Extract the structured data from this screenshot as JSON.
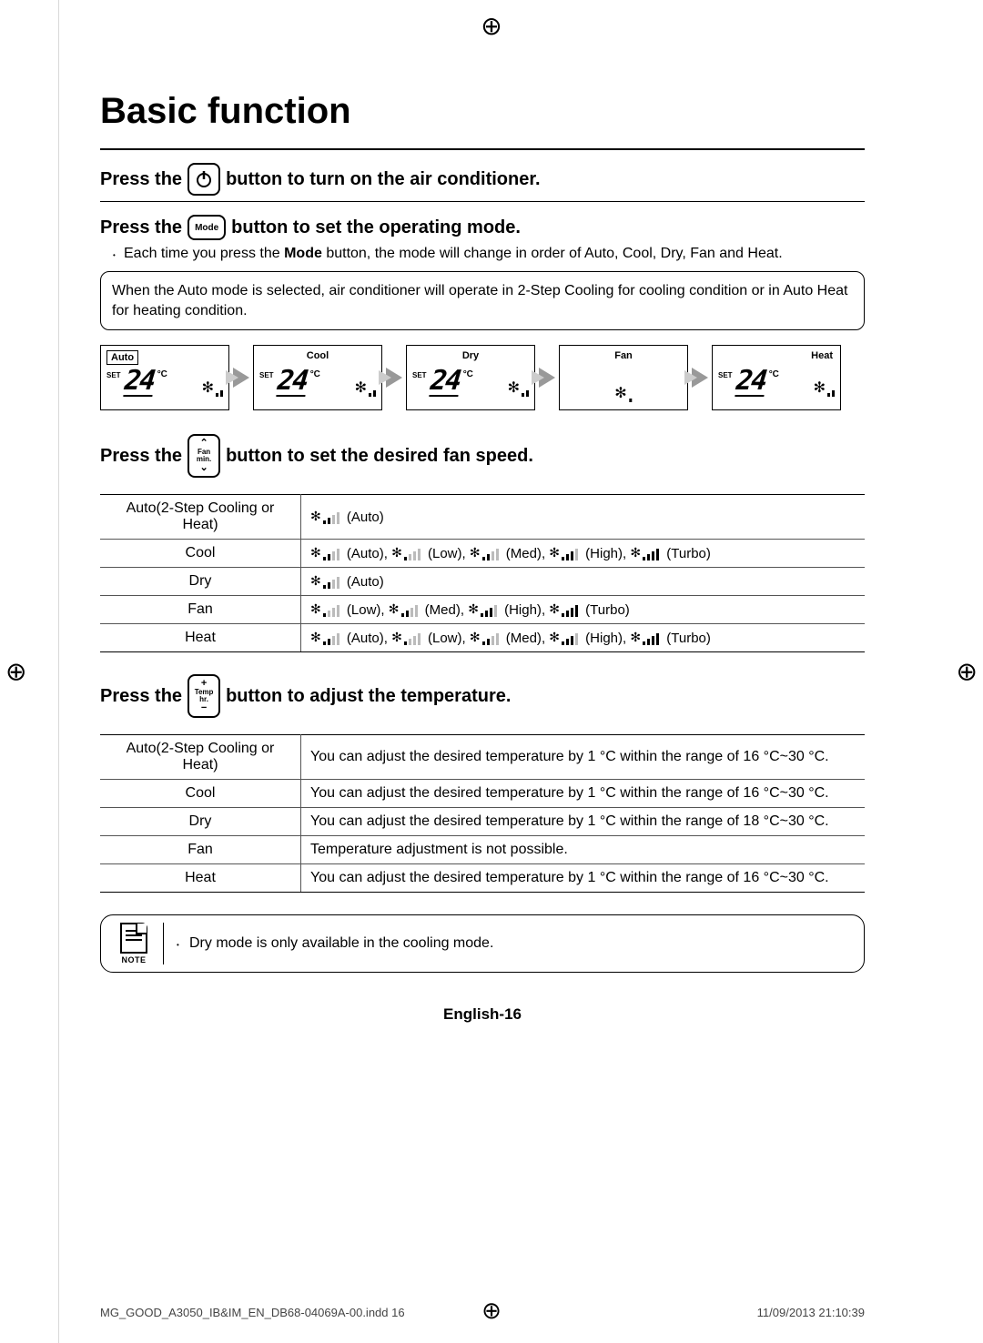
{
  "title": "Basic function",
  "sections": {
    "power": {
      "before": "Press the",
      "after": "button to turn on the air conditioner."
    },
    "mode": {
      "before": "Press the",
      "btn_label": "Mode",
      "after": "button to set the operating mode.",
      "bullet_prefix": "Each time you press the ",
      "bullet_bold": "Mode",
      "bullet_suffix": " button, the mode will change in order of Auto, Cool, Dry, Fan and Heat.",
      "note_box": "When the Auto mode is selected, air conditioner will operate in 2-Step Cooling for cooling condition or in Auto Heat for heating condition."
    },
    "fan": {
      "before": "Press the",
      "btn_line1": "Fan",
      "btn_line2": "min.",
      "after": "button to set the desired fan speed."
    },
    "temp": {
      "before": "Press the",
      "btn_line1": "Temp",
      "btn_line2": "hr.",
      "after": "button to adjust the temperature."
    }
  },
  "mode_cards": [
    {
      "label": "Auto",
      "label_pos": "boxed",
      "show_temp": true,
      "temp": "24",
      "set": "SET",
      "unit": "°C"
    },
    {
      "label": "Cool",
      "label_pos": "center",
      "show_temp": true,
      "temp": "24",
      "set": "SET",
      "unit": "°C"
    },
    {
      "label": "Dry",
      "label_pos": "center",
      "show_temp": true,
      "temp": "24",
      "set": "SET",
      "unit": "°C"
    },
    {
      "label": "Fan",
      "label_pos": "center",
      "show_temp": false
    },
    {
      "label": "Heat",
      "label_pos": "right",
      "show_temp": true,
      "temp": "24",
      "set": "SET",
      "unit": "°C"
    }
  ],
  "fan_table": [
    {
      "mode": "Auto(2-Step Cooling or Heat)",
      "speeds": [
        {
          "label": "(Auto)",
          "bars": [
            1,
            1,
            0,
            0
          ],
          "dim": true
        }
      ]
    },
    {
      "mode": "Cool",
      "speeds": [
        {
          "label": "(Auto)",
          "bars": [
            1,
            1,
            0,
            0
          ],
          "dim": true
        },
        {
          "label": "(Low)",
          "bars": [
            1,
            0,
            0,
            0
          ]
        },
        {
          "label": "(Med)",
          "bars": [
            1,
            1,
            0,
            0
          ]
        },
        {
          "label": "(High)",
          "bars": [
            1,
            1,
            1,
            0
          ]
        },
        {
          "label": "(Turbo)",
          "bars": [
            1,
            1,
            1,
            1
          ]
        }
      ]
    },
    {
      "mode": "Dry",
      "speeds": [
        {
          "label": "(Auto)",
          "bars": [
            1,
            1,
            0,
            0
          ],
          "dim": true
        }
      ]
    },
    {
      "mode": "Fan",
      "speeds": [
        {
          "label": "(Low)",
          "bars": [
            1,
            0,
            0,
            0
          ]
        },
        {
          "label": "(Med)",
          "bars": [
            1,
            1,
            0,
            0
          ]
        },
        {
          "label": "(High)",
          "bars": [
            1,
            1,
            1,
            0
          ]
        },
        {
          "label": "(Turbo)",
          "bars": [
            1,
            1,
            1,
            1
          ]
        }
      ]
    },
    {
      "mode": "Heat",
      "speeds": [
        {
          "label": "(Auto)",
          "bars": [
            1,
            1,
            0,
            0
          ],
          "dim": true
        },
        {
          "label": "(Low)",
          "bars": [
            1,
            0,
            0,
            0
          ]
        },
        {
          "label": "(Med)",
          "bars": [
            1,
            1,
            0,
            0
          ]
        },
        {
          "label": "(High)",
          "bars": [
            1,
            1,
            1,
            0
          ]
        },
        {
          "label": "(Turbo)",
          "bars": [
            1,
            1,
            1,
            1
          ]
        }
      ]
    }
  ],
  "temp_table": [
    {
      "mode": "Auto(2-Step Cooling or Heat)",
      "text": "You can adjust the desired temperature by 1 °C within the range of 16 °C~30 °C."
    },
    {
      "mode": "Cool",
      "text": "You can adjust the desired temperature by 1 °C within the range of 16 °C~30 °C."
    },
    {
      "mode": "Dry",
      "text": "You can adjust the desired temperature by 1 °C within the range of 18 °C~30 °C."
    },
    {
      "mode": "Fan",
      "text": "Temperature adjustment is not possible."
    },
    {
      "mode": "Heat",
      "text": "You can adjust the desired temperature by 1 °C within the range of 16 °C~30 °C."
    }
  ],
  "note": {
    "label": "NOTE",
    "text": "Dry mode is only available in the cooling mode."
  },
  "page_number": "English-16",
  "footer_left": "MG_GOOD_A3050_IB&IM_EN_DB68-04069A-00.indd   16",
  "footer_right": "11/09/2013   21:10:39"
}
